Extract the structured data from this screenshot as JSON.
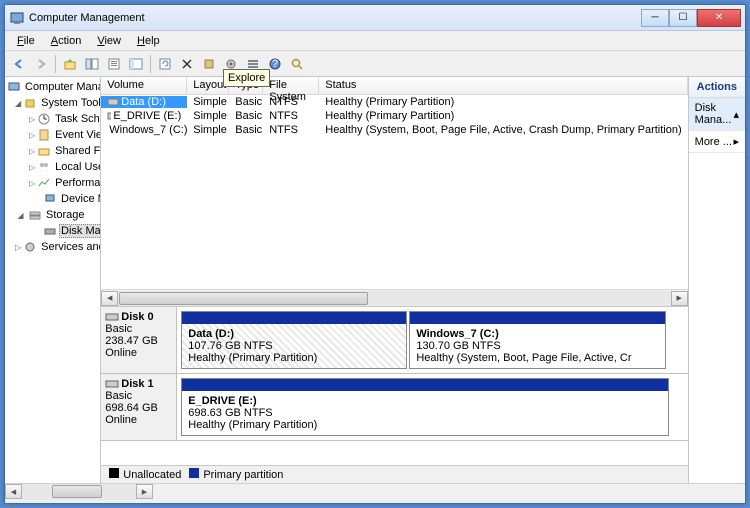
{
  "window": {
    "title": "Computer Management"
  },
  "menu": {
    "file": "File",
    "action": "Action",
    "view": "View",
    "help": "Help"
  },
  "tooltip": "Explore",
  "tree": {
    "root": "Computer Management (Local",
    "systools": "System Tools",
    "task": "Task Scheduler",
    "event": "Event Viewer",
    "shared": "Shared Folders",
    "users": "Local Users and Groups",
    "perf": "Performance",
    "devmgr": "Device Manager",
    "storage": "Storage",
    "diskmgmt": "Disk Management",
    "services": "Services and Applications"
  },
  "columns": {
    "volume": "Volume",
    "layout": "Layout",
    "type": "Type",
    "fs": "File System",
    "status": "Status"
  },
  "volumes": [
    {
      "name": "Data (D:)",
      "layout": "Simple",
      "type": "Basic",
      "fs": "NTFS",
      "status": "Healthy (Primary Partition)"
    },
    {
      "name": "E_DRIVE (E:)",
      "layout": "Simple",
      "type": "Basic",
      "fs": "NTFS",
      "status": "Healthy (Primary Partition)"
    },
    {
      "name": "Windows_7  (C:)",
      "layout": "Simple",
      "type": "Basic",
      "fs": "NTFS",
      "status": "Healthy (System, Boot, Page File, Active, Crash Dump, Primary Partition)"
    }
  ],
  "disks": [
    {
      "label": "Disk 0",
      "type": "Basic",
      "size": "238.47 GB",
      "status": "Online",
      "parts": [
        {
          "name": "Data  (D:)",
          "sub": "107.76 GB NTFS",
          "status": "Healthy (Primary Partition)",
          "hatched": true
        },
        {
          "name": "Windows_7  (C:)",
          "sub": "130.70 GB NTFS",
          "status": "Healthy (System, Boot, Page File, Active, Cr"
        }
      ]
    },
    {
      "label": "Disk 1",
      "type": "Basic",
      "size": "698.64 GB",
      "status": "Online",
      "parts": [
        {
          "name": "E_DRIVE  (E:)",
          "sub": "698.63 GB NTFS",
          "status": "Healthy (Primary Partition)"
        }
      ]
    }
  ],
  "legend": {
    "unalloc": "Unallocated",
    "primary": "Primary partition"
  },
  "actions": {
    "header": "Actions",
    "disk": "Disk Mana...",
    "more": "More ..."
  }
}
